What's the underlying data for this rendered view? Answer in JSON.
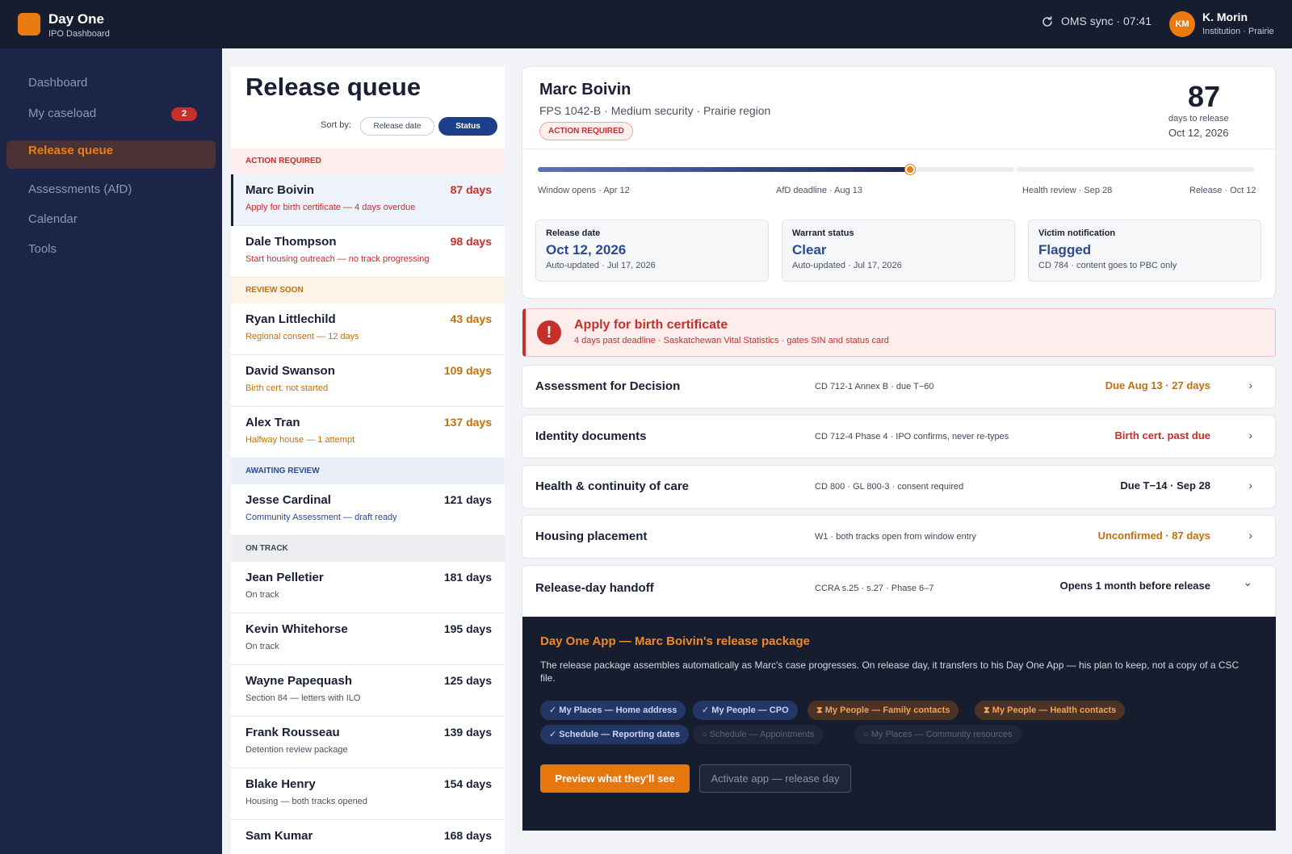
{
  "app": {
    "name": "Day One",
    "subtitle": "IPO Dashboard"
  },
  "header": {
    "sync": "OMS sync · 07:41",
    "user_initials": "KM",
    "user_name": "K. Morin",
    "user_org": "Institution · Prairie"
  },
  "sidebar": {
    "items": [
      {
        "label": "Dashboard"
      },
      {
        "label": "My caseload",
        "badge": "2"
      },
      {
        "label": "Release queue",
        "active": true
      },
      {
        "label": "Assessments (AfD)"
      },
      {
        "label": "Calendar"
      },
      {
        "label": "Tools"
      }
    ]
  },
  "queue": {
    "title": "Release queue",
    "sort_label": "Sort by:",
    "sort_options": [
      "Release date",
      "Status"
    ],
    "sort_selected": "Status",
    "sections": [
      {
        "label": "ACTION REQUIRED"
      },
      {
        "label": "REVIEW SOON"
      },
      {
        "label": "AWAITING REVIEW"
      },
      {
        "label": "ON TRACK"
      }
    ],
    "rows": [
      {
        "name": "Marc Boivin",
        "days": "87 days",
        "note": "Apply for birth certificate — 4 days overdue"
      },
      {
        "name": "Dale Thompson",
        "days": "98 days",
        "note": "Start housing outreach — no track progressing"
      },
      {
        "name": "Ryan Littlechild",
        "days": "43 days",
        "note": "Regional consent — 12 days"
      },
      {
        "name": "David Swanson",
        "days": "109 days",
        "note": "Birth cert. not started"
      },
      {
        "name": "Alex Tran",
        "days": "137 days",
        "note": "Halfway house — 1 attempt"
      },
      {
        "name": "Jesse Cardinal",
        "days": "121 days",
        "note": "Community Assessment — draft ready"
      },
      {
        "name": "Jean Pelletier",
        "days": "181 days",
        "note": "On track"
      },
      {
        "name": "Kevin Whitehorse",
        "days": "195 days",
        "note": "On track"
      },
      {
        "name": "Wayne Papequash",
        "days": "125 days",
        "note": "Section 84 — letters with ILO"
      },
      {
        "name": "Frank Rousseau",
        "days": "139 days",
        "note": "Detention review package"
      },
      {
        "name": "Blake Henry",
        "days": "154 days",
        "note": "Housing — both tracks opened"
      },
      {
        "name": "Sam Kumar",
        "days": "168 days",
        "note": ""
      }
    ]
  },
  "detail": {
    "name": "Marc Boivin",
    "subtitle": "FPS 1042-B · Medium security · Prairie region",
    "badge": "ACTION REQUIRED",
    "countdown": "87",
    "countdown_label": "days to release",
    "countdown_date": "Oct 12, 2026",
    "timeline_progress_pct": 52,
    "milestones": [
      "Window opens · Apr 12",
      "AfD deadline · Aug 13",
      "Health review · Sep 28",
      "Release · Oct 12"
    ],
    "stats": [
      {
        "label": "Release date",
        "value": "Oct 12, 2026",
        "sub": "Auto-updated · Jul 17, 2026"
      },
      {
        "label": "Warrant status",
        "value": "Clear",
        "sub": "Auto-updated · Jul 17, 2026"
      },
      {
        "label": "Victim notification",
        "value": "Flagged",
        "sub": "CD 784 · content goes to PBC only"
      }
    ]
  },
  "alert": {
    "icon": "!",
    "title": "Apply for birth certificate",
    "sub": "4 days past deadline · Saskatchewan Vital Statistics · gates SIN and status card"
  },
  "accordions": [
    {
      "title": "Assessment for Decision",
      "ref": "CD 712-1 Annex B · due T−60",
      "status": "Due Aug 13 · 27 days",
      "chevron": "›"
    },
    {
      "title": "Identity documents",
      "ref": "CD 712-4 Phase 4 · IPO confirms, never re-types",
      "status": "Birth cert. past due",
      "chevron": "›"
    },
    {
      "title": "Health & continuity of care",
      "ref": "CD 800 · GL 800-3 · consent required",
      "status": "Due T−14 · Sep 28",
      "chevron": "›"
    },
    {
      "title": "Housing placement",
      "ref": "W1 · both tracks open from window entry",
      "status": "Unconfirmed · 87 days",
      "chevron": "›"
    },
    {
      "title": "Release-day handoff",
      "ref": "CCRA s.25 · s.27 · Phase 6–7",
      "status": "Opens 1 month before release",
      "chevron": "⌄"
    }
  ],
  "panel": {
    "title": "Day One App — Marc Boivin's release package",
    "description": "The release package assembles automatically as Marc's case progresses. On release day, it transfers to his Day One App — his plan to keep, not a copy of a CSC file.",
    "chips": [
      {
        "icon": "✓",
        "label": "My Places — Home address"
      },
      {
        "icon": "✓",
        "label": "My People — CPO"
      },
      {
        "icon": "⧗",
        "label": "My People — Family contacts"
      },
      {
        "icon": "⧗",
        "label": "My People — Health contacts"
      },
      {
        "icon": "✓",
        "label": "Schedule — Reporting dates"
      },
      {
        "icon": "○",
        "label": "Schedule — Appointments"
      },
      {
        "icon": "○",
        "label": "My Places — Community resources"
      }
    ],
    "primary_button": "Preview what they'll see",
    "secondary_button": "Activate app — release day"
  },
  "colors": {
    "accent": "#ea7a12",
    "danger": "#c62f2a",
    "warning": "#c2700a",
    "info": "#2b4a93",
    "navy": "#161d2e"
  }
}
